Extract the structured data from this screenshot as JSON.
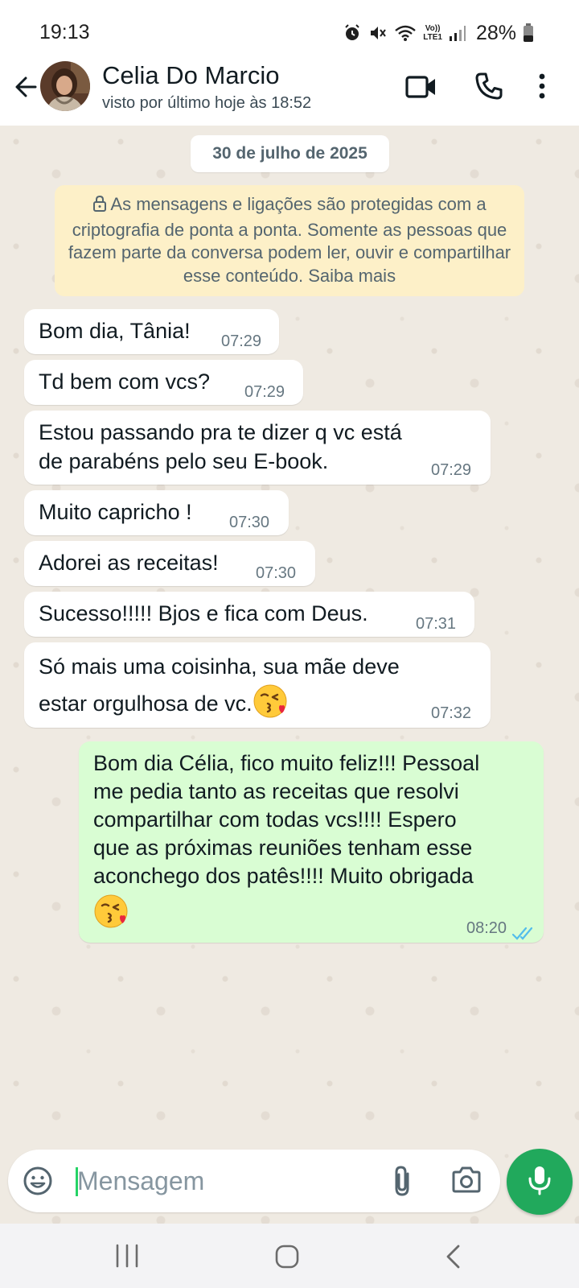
{
  "status_bar": {
    "time": "19:13",
    "network": "LTE1",
    "volte": "Vo))",
    "battery": "28%"
  },
  "header": {
    "contact_name": "Celia Do Marcio",
    "last_seen": "visto por último hoje às 18:52",
    "icons": [
      "back-arrow-icon",
      "video-call-icon",
      "phone-icon",
      "more-vert-icon"
    ]
  },
  "chat": {
    "date_label": "30 de julho de 2025",
    "encryption_notice": "As mensagens e ligações são protegidas com a criptografia de ponta a ponta. Somente as pessoas que fazem parte da conversa podem ler, ouvir e compartilhar esse conteúdo. Saiba mais",
    "messages": [
      {
        "direction": "in",
        "lines": [
          "Bom dia, Tânia!"
        ],
        "time": "07:29"
      },
      {
        "direction": "in",
        "lines": [
          "Td bem com vcs?"
        ],
        "time": "07:29"
      },
      {
        "direction": "in",
        "lines": [
          "Estou passando  pra te dizer q vc está",
          "de parabéns  pelo seu E-book."
        ],
        "time": "07:29"
      },
      {
        "direction": "in",
        "lines": [
          "Muito capricho !"
        ],
        "time": "07:30"
      },
      {
        "direction": "in",
        "lines": [
          "Adorei as receitas!"
        ],
        "time": "07:30"
      },
      {
        "direction": "in",
        "lines": [
          "Sucesso!!!!! Bjos e fica com Deus."
        ],
        "time": "07:31"
      },
      {
        "direction": "in",
        "lines": [
          "Só  mais uma coisinha, sua mãe  deve",
          "estar orgulhosa de vc."
        ],
        "emoji": "😘",
        "time": "07:32"
      },
      {
        "direction": "out",
        "lines": [
          "Bom dia Célia, fico muito feliz!!! Pessoal",
          "me pedia tanto as receitas que resolvi",
          "compartilhar com todas vcs!!!! Espero",
          "que as próximas reuniões tenham esse",
          "aconchego dos patês!!!! Muito obrigada"
        ],
        "emoji": "😘",
        "time": "08:20",
        "status": "read"
      }
    ]
  },
  "composer": {
    "placeholder": "Mensagem"
  },
  "colors": {
    "outgoing_bubble": "#d9fdd3",
    "incoming_bubble": "#ffffff",
    "chat_background": "#efeae2",
    "accent_green": "#21a95c",
    "read_ticks": "#53bdeb",
    "notice_background": "#fdf0c8"
  }
}
